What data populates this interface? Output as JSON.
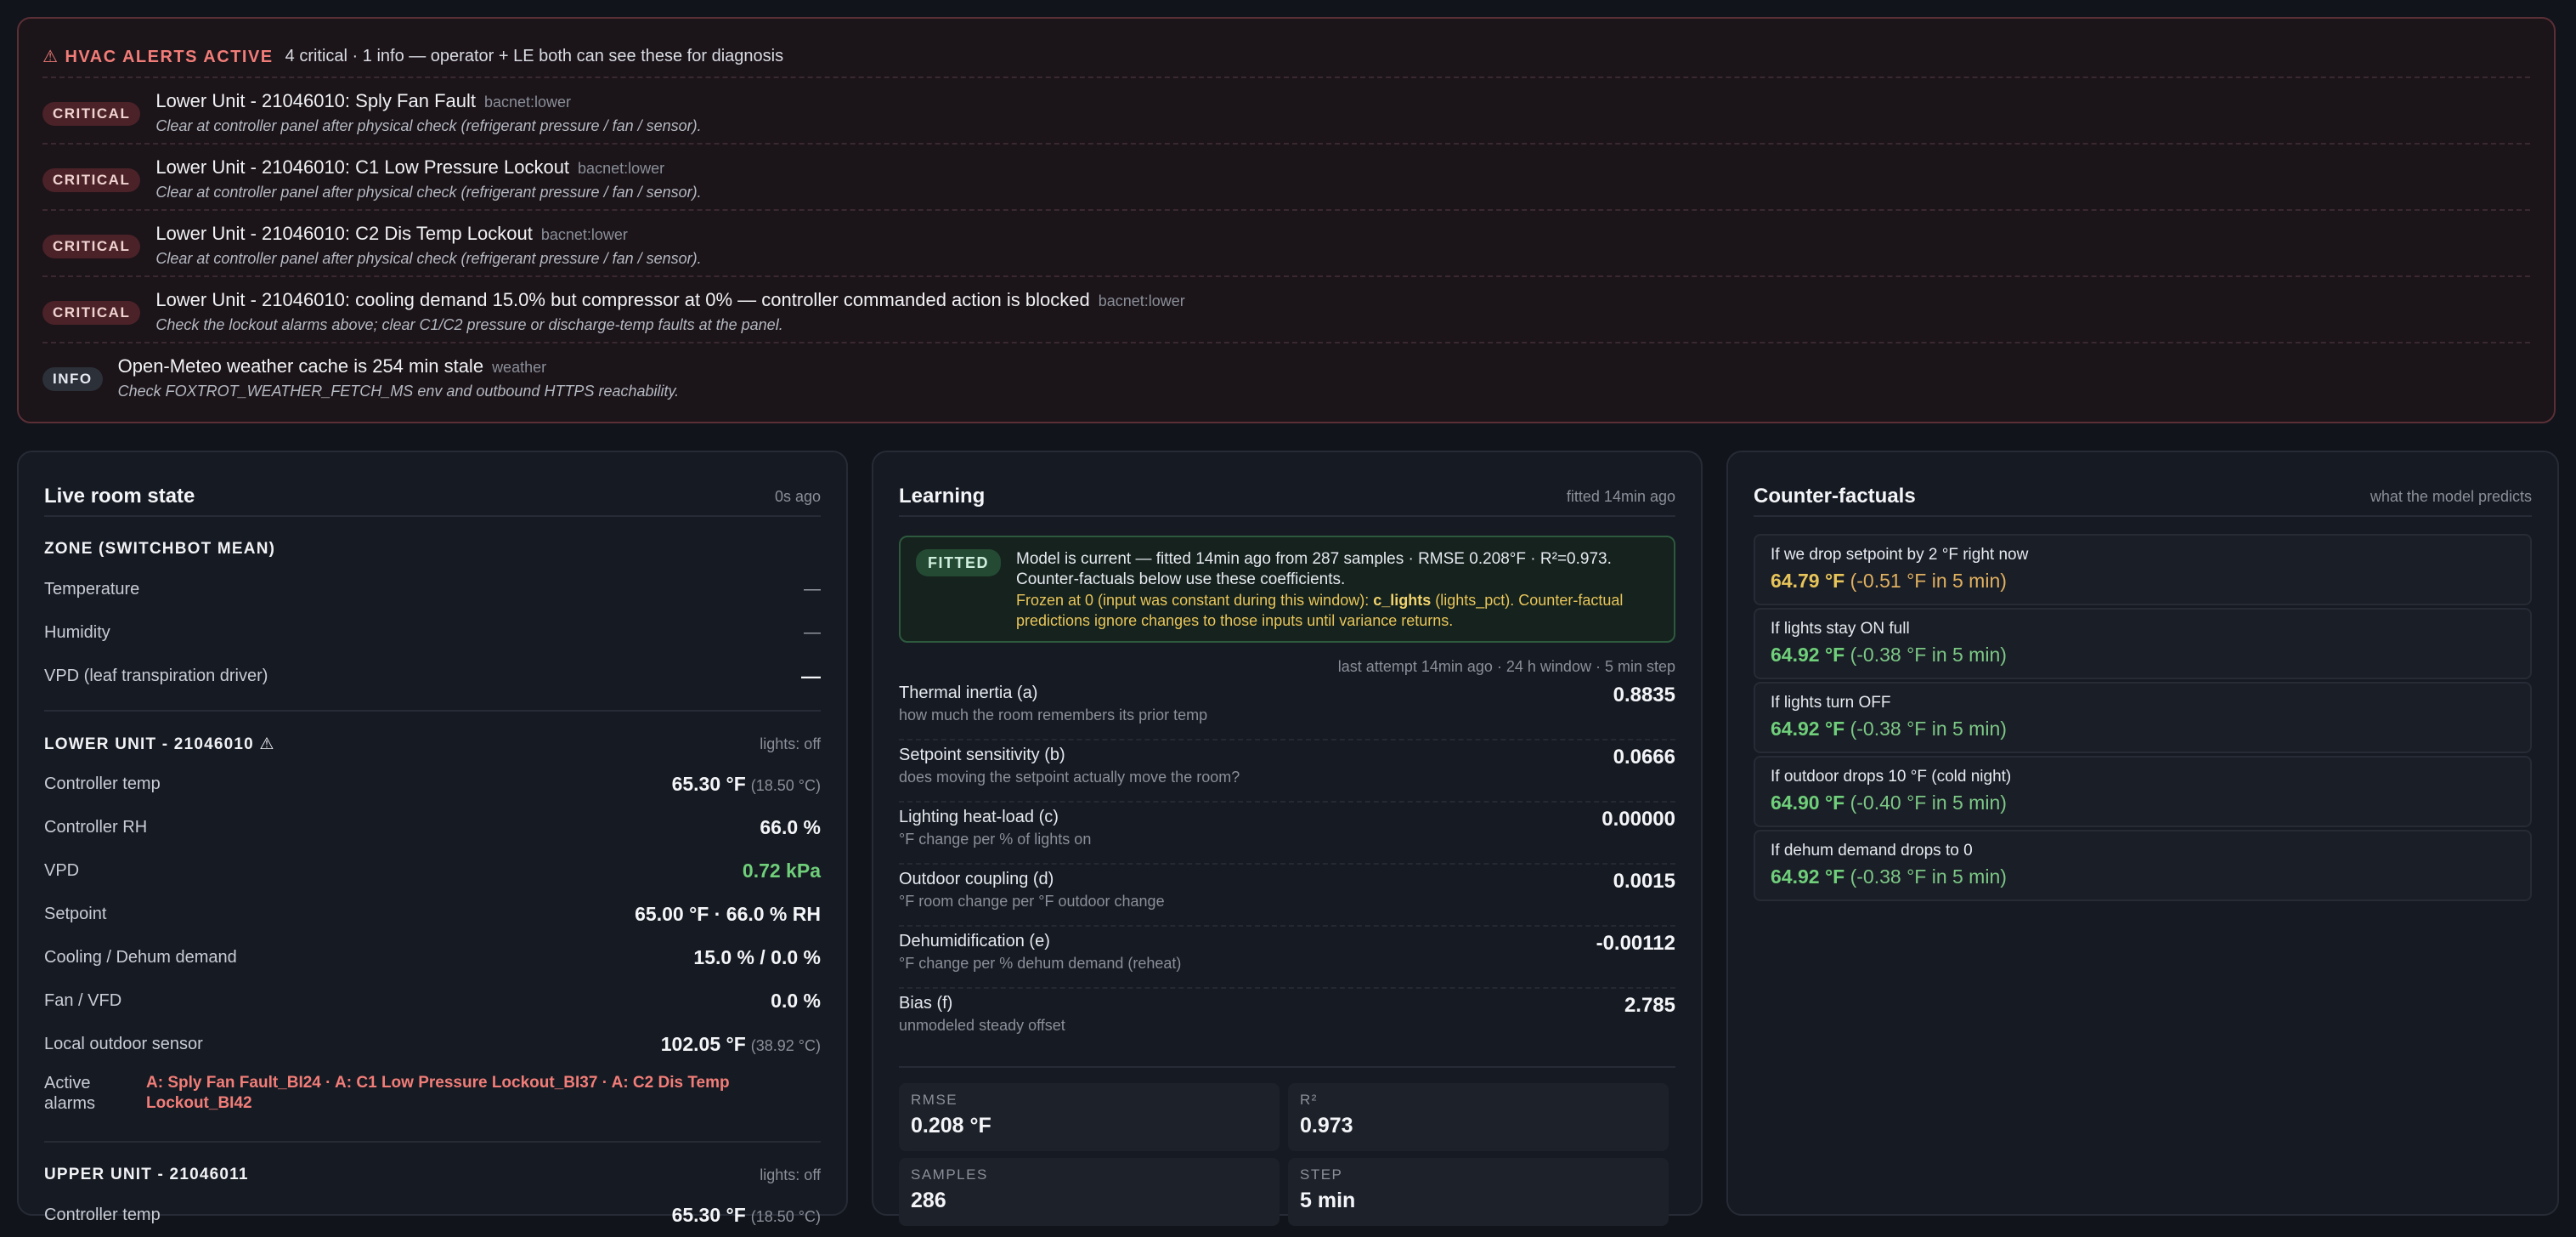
{
  "alerts": {
    "title": "⚠ HVAC ALERTS ACTIVE",
    "summary": "4 critical · 1 info — operator + LE both can see these for diagnosis",
    "items": [
      {
        "level": "CRITICAL",
        "title": "Lower Unit - 21046010: Sply Fan Fault",
        "tag": "bacnet:lower",
        "hint": "Clear at controller panel after physical check (refrigerant pressure / fan / sensor)."
      },
      {
        "level": "CRITICAL",
        "title": "Lower Unit - 21046010: C1 Low Pressure Lockout",
        "tag": "bacnet:lower",
        "hint": "Clear at controller panel after physical check (refrigerant pressure / fan / sensor)."
      },
      {
        "level": "CRITICAL",
        "title": "Lower Unit - 21046010: C2 Dis Temp Lockout",
        "tag": "bacnet:lower",
        "hint": "Clear at controller panel after physical check (refrigerant pressure / fan / sensor)."
      },
      {
        "level": "CRITICAL",
        "title": "Lower Unit - 21046010: cooling demand 15.0% but compressor at 0% — controller commanded action is blocked",
        "tag": "bacnet:lower",
        "hint": "Check the lockout alarms above; clear C1/C2 pressure or discharge-temp faults at the panel."
      },
      {
        "level": "INFO",
        "title": "Open-Meteo weather cache is 254 min stale",
        "tag": "weather",
        "hint": "Check FOXTROT_WEATHER_FETCH_MS env and outbound HTTPS reachability."
      }
    ]
  },
  "live": {
    "title": "Live room state",
    "meta": "0s ago",
    "zone": {
      "heading": "ZONE (SWITCHBOT MEAN)",
      "rows": [
        {
          "label": "Temperature",
          "value": "—"
        },
        {
          "label": "Humidity",
          "value": "—"
        },
        {
          "label": "VPD (leaf transpiration driver)",
          "value": "—"
        }
      ]
    },
    "lower": {
      "heading": "LOWER UNIT - 21046010 ⚠",
      "lights": "lights: off",
      "rows": [
        {
          "label": "Controller temp",
          "value": "65.30 °F",
          "sub": "(18.50 °C)"
        },
        {
          "label": "Controller RH",
          "value": "66.0 %",
          "sub": ""
        },
        {
          "label": "VPD",
          "value": "0.72 kPa",
          "sub": ""
        },
        {
          "label": "Setpoint",
          "value": "65.00 °F · 66.0 % RH",
          "sub": ""
        },
        {
          "label": "Cooling / Dehum demand",
          "value": "15.0 % / 0.0 %",
          "sub": ""
        },
        {
          "label": "Fan / VFD",
          "value": "0.0 %",
          "sub": ""
        },
        {
          "label": "Local outdoor sensor",
          "value": "102.05 °F",
          "sub": "(38.92 °C)"
        }
      ],
      "alarms_label": "Active alarms",
      "alarms": "A: Sply Fan Fault_BI24 · A: C1 Low Pressure Lockout_BI37 · A: C2 Dis Temp Lockout_BI42"
    },
    "upper": {
      "heading": "UPPER UNIT - 21046011",
      "lights": "lights: off",
      "rows": [
        {
          "label": "Controller temp",
          "value": "65.30 °F",
          "sub": "(18.50 °C)"
        }
      ]
    }
  },
  "learning": {
    "title": "Learning",
    "meta": "fitted 14min ago",
    "badge": "FITTED",
    "fitted_line1": "Model is current — fitted 14min ago from 287 samples · RMSE 0.208°F · R²=0.973.",
    "fitted_line2": "Counter-factuals below use these coefficients.",
    "frozen_prefix": "Frozen at 0 (input was constant during this window): ",
    "frozen_var": "c_lights",
    "frozen_suffix": " (lights_pct). Counter-factual predictions ignore changes to those inputs until variance returns.",
    "attempt": "last attempt 14min ago · 24 h window · 5 min step",
    "coefficients": [
      {
        "name": "Thermal inertia (a)",
        "desc": "how much the room remembers its prior temp",
        "value": "0.8835"
      },
      {
        "name": "Setpoint sensitivity (b)",
        "desc": "does moving the setpoint actually move the room?",
        "value": "0.0666"
      },
      {
        "name": "Lighting heat-load (c)",
        "desc": "°F change per % of lights on",
        "value": "0.00000"
      },
      {
        "name": "Outdoor coupling (d)",
        "desc": "°F room change per °F outdoor change",
        "value": "0.0015"
      },
      {
        "name": "Dehumidification (e)",
        "desc": "°F change per % dehum demand (reheat)",
        "value": "-0.00112"
      },
      {
        "name": "Bias (f)",
        "desc": "unmodeled steady offset",
        "value": "2.785"
      }
    ],
    "stats": [
      {
        "label": "RMSE",
        "value": "0.208 °F"
      },
      {
        "label": "R²",
        "value": "0.973"
      },
      {
        "label": "SAMPLES",
        "value": "286"
      },
      {
        "label": "STEP",
        "value": "5 min"
      }
    ]
  },
  "counterfactuals": {
    "title": "Counter-factuals",
    "meta": "what the model predicts",
    "items": [
      {
        "q": "If we drop setpoint by 2 °F right now",
        "value": "64.79 °F",
        "delta": "(-0.51 °F in 5 min)"
      },
      {
        "q": "If lights stay ON full",
        "value": "64.92 °F",
        "delta": "(-0.38 °F in 5 min)"
      },
      {
        "q": "If lights turn OFF",
        "value": "64.92 °F",
        "delta": "(-0.38 °F in 5 min)"
      },
      {
        "q": "If outdoor drops 10 °F (cold night)",
        "value": "64.90 °F",
        "delta": "(-0.40 °F in 5 min)"
      },
      {
        "q": "If dehum demand drops to 0",
        "value": "64.92 °F",
        "delta": "(-0.38 °F in 5 min)"
      }
    ]
  },
  "colors": {
    "critical": "#f27d78",
    "ok": "#6fcf7a",
    "warm": "#e8c55a",
    "background": "#11141b"
  }
}
